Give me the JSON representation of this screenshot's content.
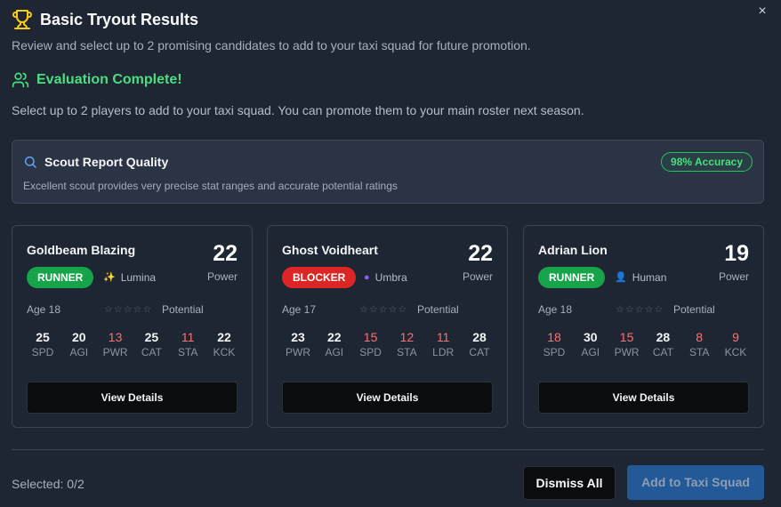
{
  "header": {
    "title": "Basic Tryout Results",
    "subtitle": "Review and select up to 2 promising candidates to add to your taxi squad for future promotion.",
    "close_label": "×"
  },
  "evaluation": {
    "title": "Evaluation Complete!",
    "description": "Select up to 2 players to add to your taxi squad. You can promote them to your main roster next season."
  },
  "scout": {
    "title": "Scout Report Quality",
    "accuracy": "98% Accuracy",
    "description": "Excellent scout provides very precise stat ranges and accurate potential ratings"
  },
  "players": [
    {
      "name": "Goldbeam Blazing",
      "power": "22",
      "power_label": "Power",
      "position": "RUNNER",
      "race": "Lumina",
      "race_icon": "sparkles-icon",
      "age": "Age 18",
      "stars": "☆☆☆☆☆",
      "potential_label": "Potential",
      "stats": [
        {
          "value": "25",
          "key": "SPD",
          "low": false
        },
        {
          "value": "20",
          "key": "AGI",
          "low": false
        },
        {
          "value": "13",
          "key": "PWR",
          "low": true
        },
        {
          "value": "25",
          "key": "CAT",
          "low": false
        },
        {
          "value": "11",
          "key": "STA",
          "low": true
        },
        {
          "value": "22",
          "key": "KCK",
          "low": false
        }
      ],
      "view_label": "View Details"
    },
    {
      "name": "Ghost Voidheart",
      "power": "22",
      "power_label": "Power",
      "position": "BLOCKER",
      "race": "Umbra",
      "race_icon": "shadow-orb-icon",
      "age": "Age 17",
      "stars": "☆☆☆☆☆",
      "potential_label": "Potential",
      "stats": [
        {
          "value": "23",
          "key": "PWR",
          "low": false
        },
        {
          "value": "22",
          "key": "AGI",
          "low": false
        },
        {
          "value": "15",
          "key": "SPD",
          "low": true
        },
        {
          "value": "12",
          "key": "STA",
          "low": true
        },
        {
          "value": "11",
          "key": "LDR",
          "low": true
        },
        {
          "value": "28",
          "key": "CAT",
          "low": false
        }
      ],
      "view_label": "View Details"
    },
    {
      "name": "Adrian Lion",
      "power": "19",
      "power_label": "Power",
      "position": "RUNNER",
      "race": "Human",
      "race_icon": "person-icon",
      "age": "Age 18",
      "stars": "☆☆☆☆☆",
      "potential_label": "Potential",
      "stats": [
        {
          "value": "18",
          "key": "SPD",
          "low": true
        },
        {
          "value": "30",
          "key": "AGI",
          "low": false
        },
        {
          "value": "15",
          "key": "PWR",
          "low": true
        },
        {
          "value": "28",
          "key": "CAT",
          "low": false
        },
        {
          "value": "8",
          "key": "STA",
          "low": true
        },
        {
          "value": "9",
          "key": "KCK",
          "low": true
        }
      ],
      "view_label": "View Details"
    }
  ],
  "footer": {
    "selected": "Selected: 0/2",
    "dismiss_label": "Dismiss All",
    "add_label": "Add to Taxi Squad"
  },
  "colors": {
    "background": "#1e2633",
    "success": "#4ade80",
    "runner": "#16a34a",
    "blocker": "#dc2626",
    "low_stat": "#f87171",
    "primary_disabled": "#2563a8"
  }
}
